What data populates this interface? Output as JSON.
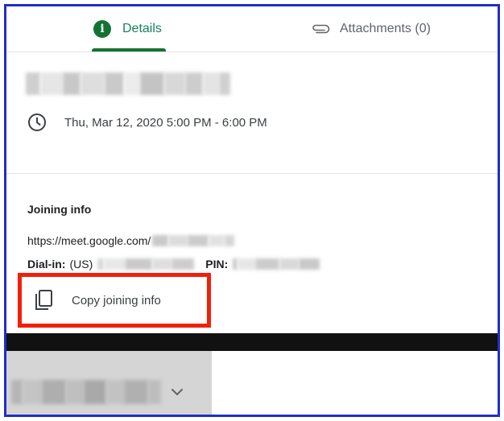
{
  "tabs": {
    "details_label": "Details",
    "attachments_label": "Attachments (0)"
  },
  "event": {
    "datetime": "Thu, Mar 12, 2020 5:00 PM - 6:00 PM"
  },
  "joining": {
    "heading": "Joining info",
    "meet_link": "https://meet.google.com/",
    "dial_in_label": "Dial-in:",
    "dial_in_region": "(US)",
    "pin_label": "PIN:",
    "copy_label": "Copy joining info"
  },
  "icons": {
    "details": "info-icon",
    "attachments": "paperclip-icon",
    "time": "clock-icon",
    "copy": "copy-icon",
    "dropdown": "chevron-down-icon"
  },
  "colors": {
    "accent_green": "#137333",
    "highlight_red": "#f0200c",
    "frame_blue": "#1f2fc8"
  }
}
